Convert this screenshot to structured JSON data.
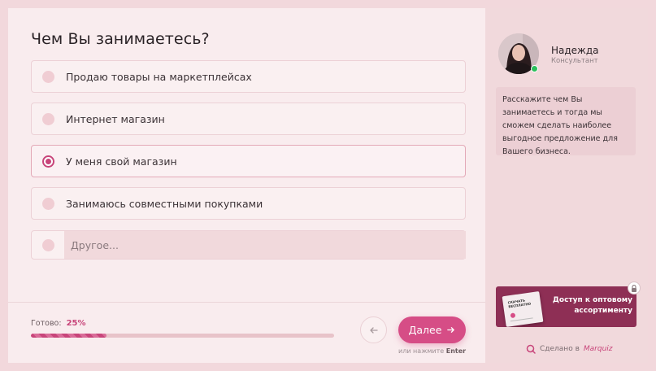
{
  "quiz": {
    "question": "Чем Вы занимаетесь?",
    "options": [
      {
        "label": "Продаю товары на маркетплейсах",
        "selected": false
      },
      {
        "label": "Интернет магазин",
        "selected": false
      },
      {
        "label": "У меня свой магазин",
        "selected": true
      },
      {
        "label": "Занимаюсь совместными покупками",
        "selected": false
      }
    ],
    "other_placeholder": "Другое..."
  },
  "footer": {
    "progress_label": "Готово:",
    "progress_value": "25%",
    "progress_fraction": 0.25,
    "next_label": "Далее",
    "hint_prefix": "или нажмите",
    "hint_key": "Enter"
  },
  "sidebar": {
    "agent_name": "Надежда",
    "agent_role": "Консультант",
    "message": "Расскажите чем Вы занимаетесь и тогда мы сможем сделать наиболее выгодное предложение для Вашего бизнеса.",
    "promo_text": "Доступ к оптовому ассортименту",
    "promo_book_title": "СКАЧАТЬ БЕСПЛАТНО",
    "credit_prefix": "Сделано в",
    "credit_brand": "Marquiz"
  },
  "colors": {
    "accent": "#d64d86",
    "online": "#2bbf5c",
    "promo": "#8e2f55"
  }
}
